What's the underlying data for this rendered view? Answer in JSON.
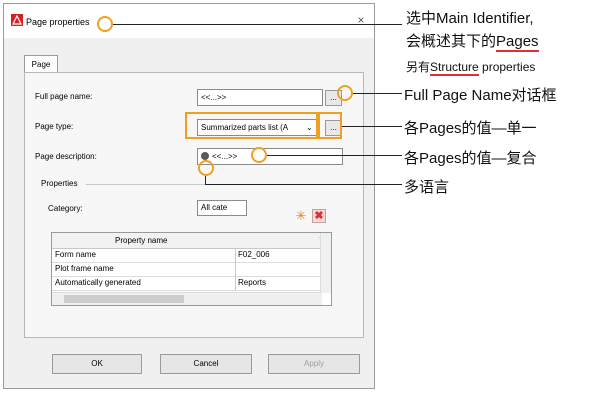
{
  "dialog": {
    "title": "Page properties",
    "tab": "Page",
    "fields": {
      "full_page_name_label": "Full page name:",
      "full_page_name_value": "<<...>>",
      "page_type_label": "Page type:",
      "page_type_value": "Summarized parts list (A",
      "page_description_label": "Page description:",
      "page_description_value": "<<...>>",
      "browse_label": "..."
    },
    "properties": {
      "group_label": "Properties",
      "category_label": "Category:",
      "category_value": "All cate",
      "table_header": "Property name",
      "table_header_2": "V",
      "rows": [
        {
          "name": "Form name",
          "value": "F02_006"
        },
        {
          "name": "Plot frame name",
          "value": ""
        },
        {
          "name": "Automatically generated",
          "value": "Reports"
        }
      ]
    },
    "buttons": {
      "ok": "OK",
      "cancel": "Cancel",
      "apply": "Apply"
    }
  },
  "annotations": {
    "a1_line1": "选中Main Identifier,",
    "a1_line2_prefix": "会概述其下的",
    "a1_line2_highlight": "Pages",
    "a1_line3_prefix": "另有",
    "a1_line3_highlight": "Structure",
    "a1_line3_suffix": " properties",
    "a2": "Full Page Name对话框",
    "a3": "各Pages的值—单一",
    "a4": "各Pages的值—复合",
    "a5": "多语言"
  },
  "colors": {
    "callout": "#f0a020",
    "underline": "#e03030",
    "delete_icon": "#d83030"
  }
}
